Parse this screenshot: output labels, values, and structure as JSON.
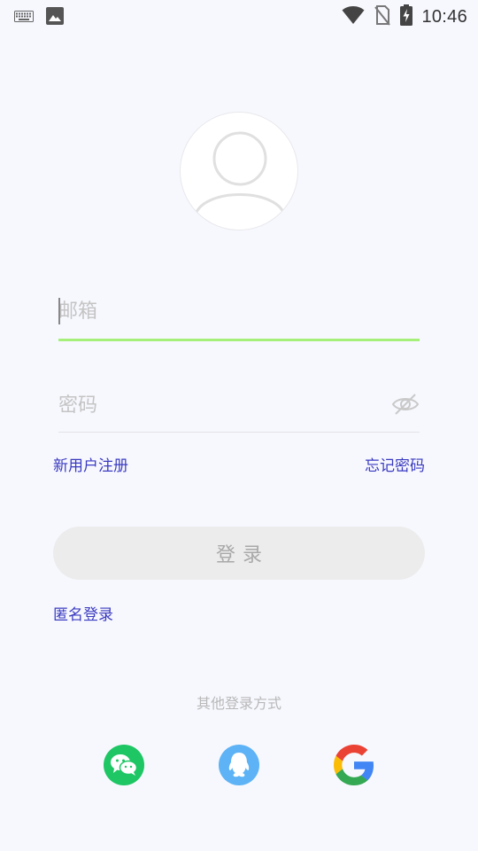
{
  "status_bar": {
    "time": "10:46",
    "icons": [
      "keyboard-icon",
      "image-icon",
      "wifi-icon",
      "no-sim-icon",
      "battery-charging-icon"
    ]
  },
  "login_form": {
    "email_placeholder": "邮箱",
    "password_placeholder": "密码",
    "register_label": "新用户注册",
    "forgot_label": "忘记密码",
    "login_button_label": "登录",
    "anonymous_label": "匿名登录",
    "other_methods_label": "其他登录方式"
  },
  "social_logins": [
    {
      "name": "wechat",
      "icon": "wechat-icon",
      "color": "#1ec664"
    },
    {
      "name": "qq",
      "icon": "qq-icon",
      "color": "#5db3f5"
    },
    {
      "name": "google",
      "icon": "google-icon",
      "color": "#4285f4"
    }
  ],
  "colors": {
    "background": "#f7f8fe",
    "accent_underline": "#a6f07a",
    "link": "#3a3ac0",
    "button_bg": "#ececec"
  }
}
